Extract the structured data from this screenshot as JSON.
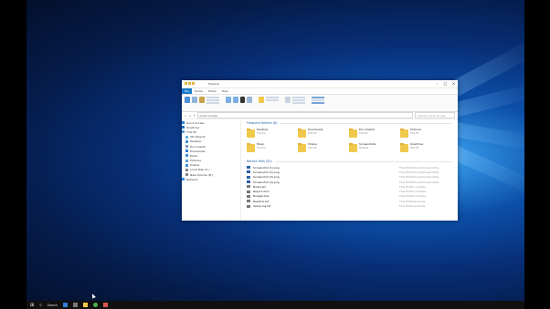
{
  "window": {
    "title": "Explorer",
    "controls": [
      "–",
      "□",
      "✕"
    ]
  },
  "ribbon": {
    "tabs": [
      "File",
      "Home",
      "Share",
      "View"
    ],
    "group_labels": [
      "Clipboard",
      "Organize",
      "New",
      "Open",
      "Select"
    ]
  },
  "address": {
    "path": "Quick access",
    "search_placeholder": "Search Quick access"
  },
  "nav": {
    "items": [
      {
        "label": "Quick access",
        "icon": "star-icon",
        "color": "#2f7fd6"
      },
      {
        "label": "OneDrive",
        "icon": "cloud-icon",
        "color": "#1a73c9"
      },
      {
        "label": "This PC",
        "icon": "computer-icon",
        "color": "#5aa0e0"
      },
      {
        "label": "3D Objects",
        "icon": "cube-icon",
        "color": "#6ab8e8"
      },
      {
        "label": "Desktop",
        "icon": "desktop-icon",
        "color": "#3d8fd8"
      },
      {
        "label": "Documents",
        "icon": "document-icon",
        "color": "#7a9cc4"
      },
      {
        "label": "Downloads",
        "icon": "download-icon",
        "color": "#2f7fd6"
      },
      {
        "label": "Music",
        "icon": "music-icon",
        "color": "#3d8fd8"
      },
      {
        "label": "Pictures",
        "icon": "picture-icon",
        "color": "#5aa0e0"
      },
      {
        "label": "Videos",
        "icon": "video-icon",
        "color": "#3d8fd8"
      },
      {
        "label": "Local Disk (C:)",
        "icon": "drive-icon",
        "color": "#888"
      },
      {
        "label": "New Volume (D:)",
        "icon": "drive-icon",
        "color": "#888"
      },
      {
        "label": "Network",
        "icon": "network-icon",
        "color": "#3d8fd8"
      }
    ]
  },
  "frequent": {
    "heading": "Frequent folders (8)",
    "folders": [
      {
        "name": "Desktop",
        "sub": "This PC"
      },
      {
        "name": "Downloads",
        "sub": "This PC"
      },
      {
        "name": "Documents",
        "sub": "This PC"
      },
      {
        "name": "Pictures",
        "sub": "This PC"
      },
      {
        "name": "Music",
        "sub": "This PC"
      },
      {
        "name": "Videos",
        "sub": "This PC"
      },
      {
        "name": "Screenshots",
        "sub": "Pictures"
      },
      {
        "name": "OneDrive",
        "sub": "This PC"
      }
    ]
  },
  "recent": {
    "heading": "Recent files (20)",
    "files": [
      {
        "name": "Screenshot (1).png",
        "path": "This PC\\Pictures\\Screenshots"
      },
      {
        "name": "Screenshot (2).png",
        "path": "This PC\\Pictures\\Screenshots"
      },
      {
        "name": "Screenshot (3).png",
        "path": "This PC\\Pictures\\Screenshots"
      },
      {
        "name": "Screenshot (4).png",
        "path": "This PC\\Pictures\\Screenshots"
      },
      {
        "name": "Notes.txt",
        "path": "This PC\\Documents"
      },
      {
        "name": "Report.docx",
        "path": "This PC\\Documents"
      },
      {
        "name": "Budget.xlsx",
        "path": "This PC\\Documents"
      },
      {
        "name": "Readme.txt",
        "path": "This PC\\Downloads"
      },
      {
        "name": "Setup log.txt",
        "path": "This PC\\Downloads"
      }
    ]
  },
  "taskbar": {
    "search_label": "Search"
  }
}
